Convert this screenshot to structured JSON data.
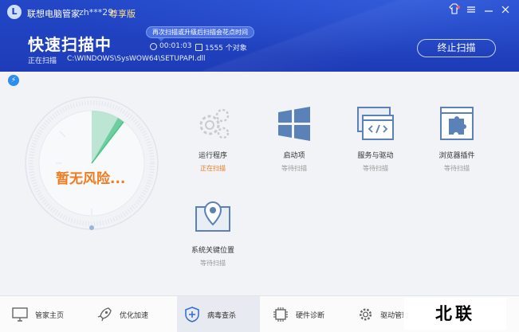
{
  "header": {
    "app_title": "联想电脑管家",
    "user_name": "zh***29",
    "user_tier": "尊享版",
    "logo_letter": "L",
    "scan_title": "快速扫描中",
    "tooltip": "再次扫描或升级后扫描会花点时间",
    "elapsed": "00:01:03",
    "file_count": "1555 个对象",
    "current_label": "正在扫描",
    "current_path": "C:\\WINDOWS\\SysWOW64\\SETUPAPI.dll",
    "stop_label": "终止扫描",
    "window_buttons": {
      "skin": "skin-icon",
      "menu": "menu-icon",
      "minimize": "minimize-icon",
      "close": "close-icon"
    },
    "bg_color": "#2247c7"
  },
  "radar": {
    "status_text": "暂无风险..."
  },
  "scan_items": [
    {
      "name": "运行程序",
      "status": "正在扫描",
      "active": true,
      "icon": "gears-icon"
    },
    {
      "name": "启动项",
      "status": "等待扫描",
      "active": false,
      "icon": "windows-icon"
    },
    {
      "name": "服务与驱动",
      "status": "等待扫描",
      "active": false,
      "icon": "code-window-icon"
    },
    {
      "name": "浏览器插件",
      "status": "等待扫描",
      "active": false,
      "icon": "puzzle-icon"
    },
    {
      "name": "系统关键位置",
      "status": "等待扫描",
      "active": false,
      "icon": "location-pin-icon"
    }
  ],
  "nav": [
    {
      "label": "管家主页",
      "icon": "monitor-icon",
      "active": false
    },
    {
      "label": "优化加速",
      "icon": "rocket-icon",
      "active": false
    },
    {
      "label": "病毒查杀",
      "icon": "shield-icon",
      "active": true
    },
    {
      "label": "硬件诊断",
      "icon": "chip-icon",
      "active": false
    },
    {
      "label": "驱动管理",
      "icon": "gear-icon",
      "active": false
    }
  ],
  "watermark": "北联",
  "colors": {
    "accent": "#1e3cb8",
    "active_status": "#f07c1f",
    "radar_green": "#4cc38a"
  }
}
